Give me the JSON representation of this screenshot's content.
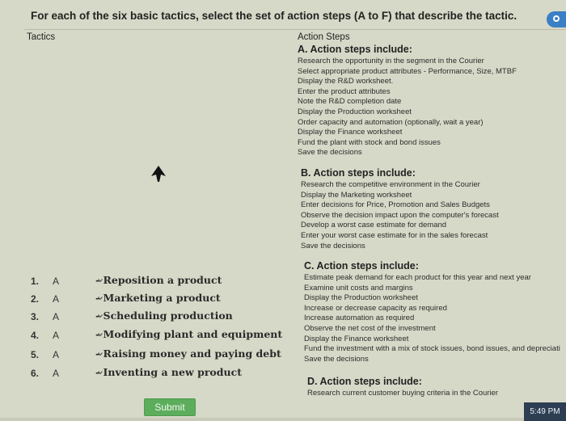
{
  "question": "For each of the six basic tactics, select the set of action steps (A to F) that describe the tactic.",
  "headers": {
    "tactics": "Tactics",
    "action_steps": "Action Steps"
  },
  "action_blocks": [
    {
      "title": "A. Action steps include:",
      "lines": [
        "Research the opportunity in the segment in the Courier",
        "Select appropriate product attributes - Performance, Size, MTBF",
        "Display the R&D worksheet.",
        "Enter the product attributes",
        "Note the R&D completion date",
        "Display the Production worksheet",
        "Order capacity and automation (optionally, wait a year)",
        "Display the Finance worksheet",
        "Fund the plant with stock and bond issues",
        "Save the decisions"
      ]
    },
    {
      "title": "B. Action steps include:",
      "lines": [
        "Research the competitive environment in the Courier",
        "Display the Marketing worksheet",
        "Enter decisions for Price, Promotion and Sales Budgets",
        "Observe the decision impact upon the computer's forecast",
        "Develop a worst case estimate for demand",
        "Enter your worst case estimate for in the sales forecast",
        "Save the decisions"
      ]
    },
    {
      "title": "C. Action steps include:",
      "lines": [
        "Estimate peak demand for each product for this year and next year",
        "Examine unit costs and margins",
        "Display the Production worksheet",
        "Increase or decrease capacity as required",
        "Increase automation as required",
        "Observe the net cost of the investment",
        "Display the Finance worksheet",
        "Fund the investment with a mix of stock issues, bond issues, and depreciati",
        "Save the decisions"
      ]
    },
    {
      "title": "D. Action steps include:",
      "lines": [
        "Research current customer buying criteria in the Courier"
      ]
    }
  ],
  "tactics": [
    {
      "num": "1.",
      "selected": "A",
      "label": "- Reposition a product"
    },
    {
      "num": "2.",
      "selected": "A",
      "label": "- Marketing a product"
    },
    {
      "num": "3.",
      "selected": "A",
      "label": "- Scheduling production"
    },
    {
      "num": "4.",
      "selected": "A",
      "label": "- Modifying plant and equipment"
    },
    {
      "num": "5.",
      "selected": "A",
      "label": "- Raising money and paying debt"
    },
    {
      "num": "6.",
      "selected": "A",
      "label": "- Inventing a new product"
    }
  ],
  "submit_label": "Submit",
  "clock": "5:49 PM",
  "colors": {
    "submit": "#5cad5c",
    "info_icon": "#3b7fc4",
    "background": "#d7d9c8"
  },
  "icons": {
    "info": "info-icon",
    "pointer": "pointer-cursor-icon",
    "chevron": "chevron-down-icon"
  }
}
